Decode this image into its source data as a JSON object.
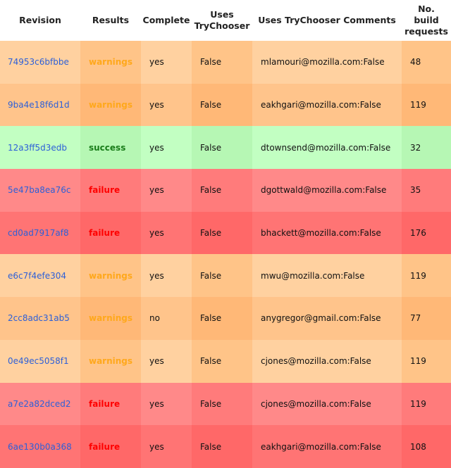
{
  "table": {
    "headers": {
      "revision": "Revision",
      "results": "Results",
      "complete": "Complete",
      "uses_trychooser_1": "Uses",
      "uses_trychooser_2": "TryChooser",
      "comments": "Uses TryChooser Comments",
      "build_1": "No.",
      "build_2": "build",
      "build_3": "requests"
    },
    "rows": [
      {
        "revision": "74953c6bfbbe",
        "result": "warnings",
        "complete": "yes",
        "uses": "False",
        "comment": "mlamouri@mozilla.com:False",
        "builds": "48"
      },
      {
        "revision": "9ba4e18f6d1d",
        "result": "warnings",
        "complete": "yes",
        "uses": "False",
        "comment": "eakhgari@mozilla.com:False",
        "builds": "119"
      },
      {
        "revision": "12a3ff5d3edb",
        "result": "success",
        "complete": "yes",
        "uses": "False",
        "comment": "dtownsend@mozilla.com:False",
        "builds": "32"
      },
      {
        "revision": "5e47ba8ea76c",
        "result": "failure",
        "complete": "yes",
        "uses": "False",
        "comment": "dgottwald@mozilla.com:False",
        "builds": "35"
      },
      {
        "revision": "cd0ad7917af8",
        "result": "failure",
        "complete": "yes",
        "uses": "False",
        "comment": "bhackett@mozilla.com:False",
        "builds": "176"
      },
      {
        "revision": "e6c7f4efe304",
        "result": "warnings",
        "complete": "yes",
        "uses": "False",
        "comment": "mwu@mozilla.com:False",
        "builds": "119"
      },
      {
        "revision": "2cc8adc31ab5",
        "result": "warnings",
        "complete": "no",
        "uses": "False",
        "comment": "anygregor@gmail.com:False",
        "builds": "77"
      },
      {
        "revision": "0e49ec5058f1",
        "result": "warnings",
        "complete": "yes",
        "uses": "False",
        "comment": "cjones@mozilla.com:False",
        "builds": "119"
      },
      {
        "revision": "a7e2a82dced2",
        "result": "failure",
        "complete": "yes",
        "uses": "False",
        "comment": "cjones@mozilla.com:False",
        "builds": "119"
      },
      {
        "revision": "6ae130b0a368",
        "result": "failure",
        "complete": "yes",
        "uses": "False",
        "comment": "eakhgari@mozilla.com:False",
        "builds": "108"
      }
    ]
  },
  "colors": {
    "revision_link": "#2c5fd8",
    "warnings": "#ffa81c",
    "success": "#1a7d1a",
    "failure": "#ff0000"
  }
}
